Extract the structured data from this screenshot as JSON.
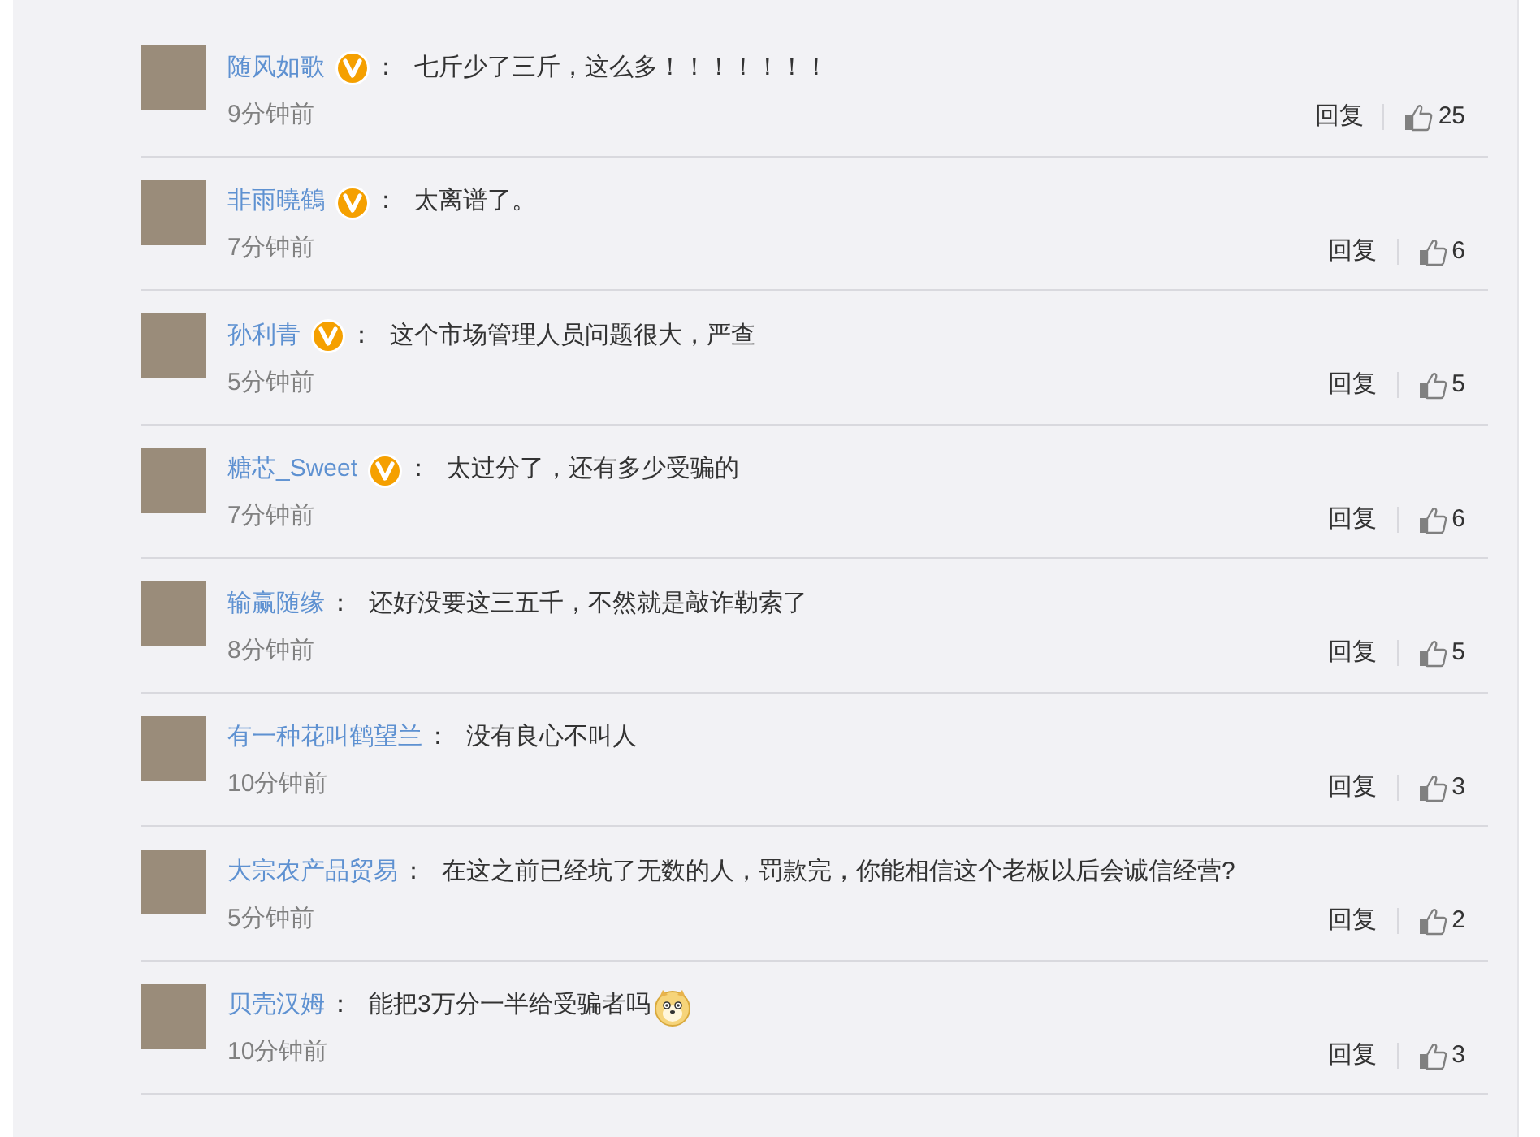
{
  "comments": [
    {
      "user": "随风如歌",
      "verified": true,
      "colon": "：",
      "text": "七斤少了三斤，这么多！！！！！！！",
      "emoji": false,
      "time": "9分钟前",
      "reply": "回复",
      "likes": "25"
    },
    {
      "user": "非雨曉鶴",
      "verified": true,
      "colon": "：",
      "text": "太离谱了。",
      "emoji": false,
      "time": "7分钟前",
      "reply": "回复",
      "likes": "6"
    },
    {
      "user": "孙利青",
      "verified": true,
      "colon": "：",
      "text": "这个市场管理人员问题很大，严查",
      "emoji": false,
      "time": "5分钟前",
      "reply": "回复",
      "likes": "5"
    },
    {
      "user": "糖芯_Sweet",
      "verified": true,
      "colon": "：",
      "text": "太过分了，还有多少受骗的",
      "emoji": false,
      "time": "7分钟前",
      "reply": "回复",
      "likes": "6"
    },
    {
      "user": "输赢随缘",
      "verified": false,
      "colon": "：",
      "text": "还好没要这三五千，不然就是敲诈勒索了",
      "emoji": false,
      "time": "8分钟前",
      "reply": "回复",
      "likes": "5"
    },
    {
      "user": "有一种花叫鹤望兰",
      "verified": false,
      "colon": "：",
      "text": "没有良心不叫人",
      "emoji": false,
      "time": "10分钟前",
      "reply": "回复",
      "likes": "3"
    },
    {
      "user": "大宗农产品贸易",
      "verified": false,
      "colon": "：",
      "text": "在这之前已经坑了无数的人，罚款完，你能相信这个老板以后会诚信经营?",
      "emoji": false,
      "time": "5分钟前",
      "reply": "回复",
      "likes": "2"
    },
    {
      "user": "贝壳汉姆",
      "verified": false,
      "colon": "：",
      "text": "能把3万分一半给受骗者吗",
      "emoji": true,
      "time": "10分钟前",
      "reply": "回复",
      "likes": "3"
    }
  ]
}
